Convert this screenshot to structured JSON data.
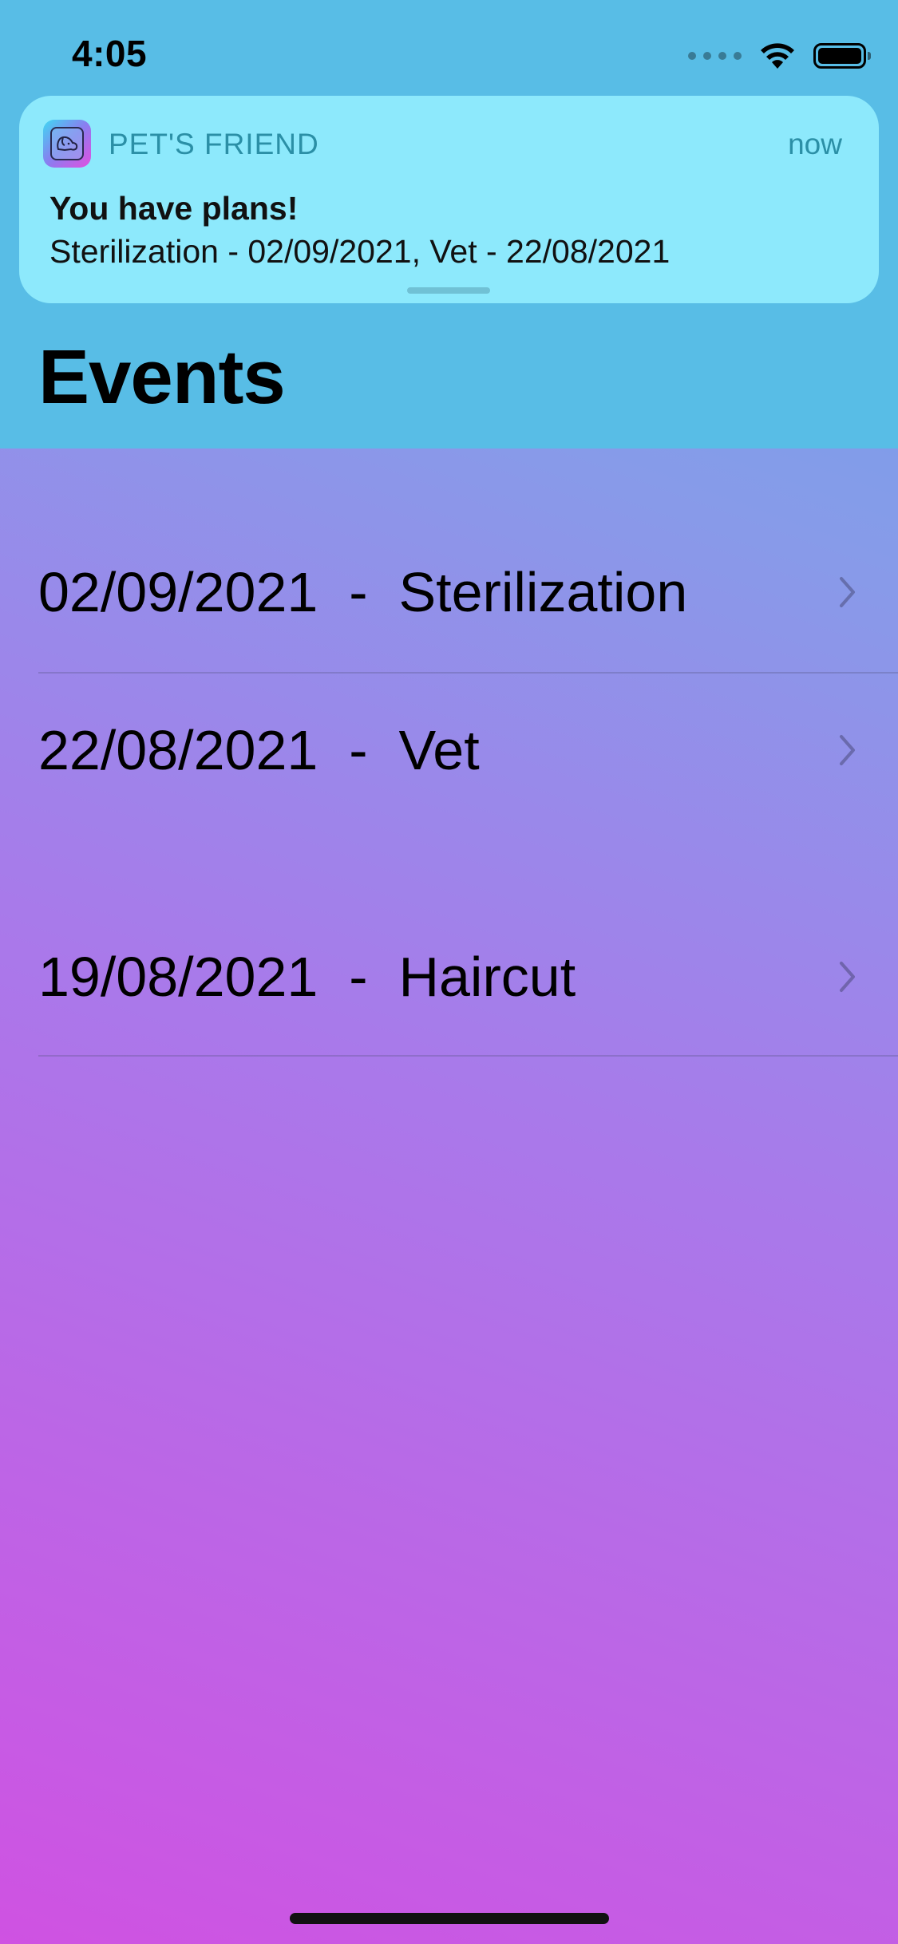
{
  "status_bar": {
    "time": "4:05"
  },
  "notification": {
    "app_name": "PET'S FRIEND",
    "time": "now",
    "title": "You have plans!",
    "body": "Sterilization - 02/09/2021, Vet - 22/08/2021",
    "app_icon": "dog-icon"
  },
  "page": {
    "title": "Events"
  },
  "events": [
    {
      "label": "02/09/2021  -  Sterilization"
    },
    {
      "label": "22/08/2021  -  Vet"
    },
    {
      "label": "19/08/2021  -  Haircut"
    }
  ],
  "colors": {
    "header_background": "#58bde6",
    "notification_background": "#8de9fc",
    "gradient_bottom": "#cf52e2",
    "gradient_top_right": "#6aa2ea"
  }
}
